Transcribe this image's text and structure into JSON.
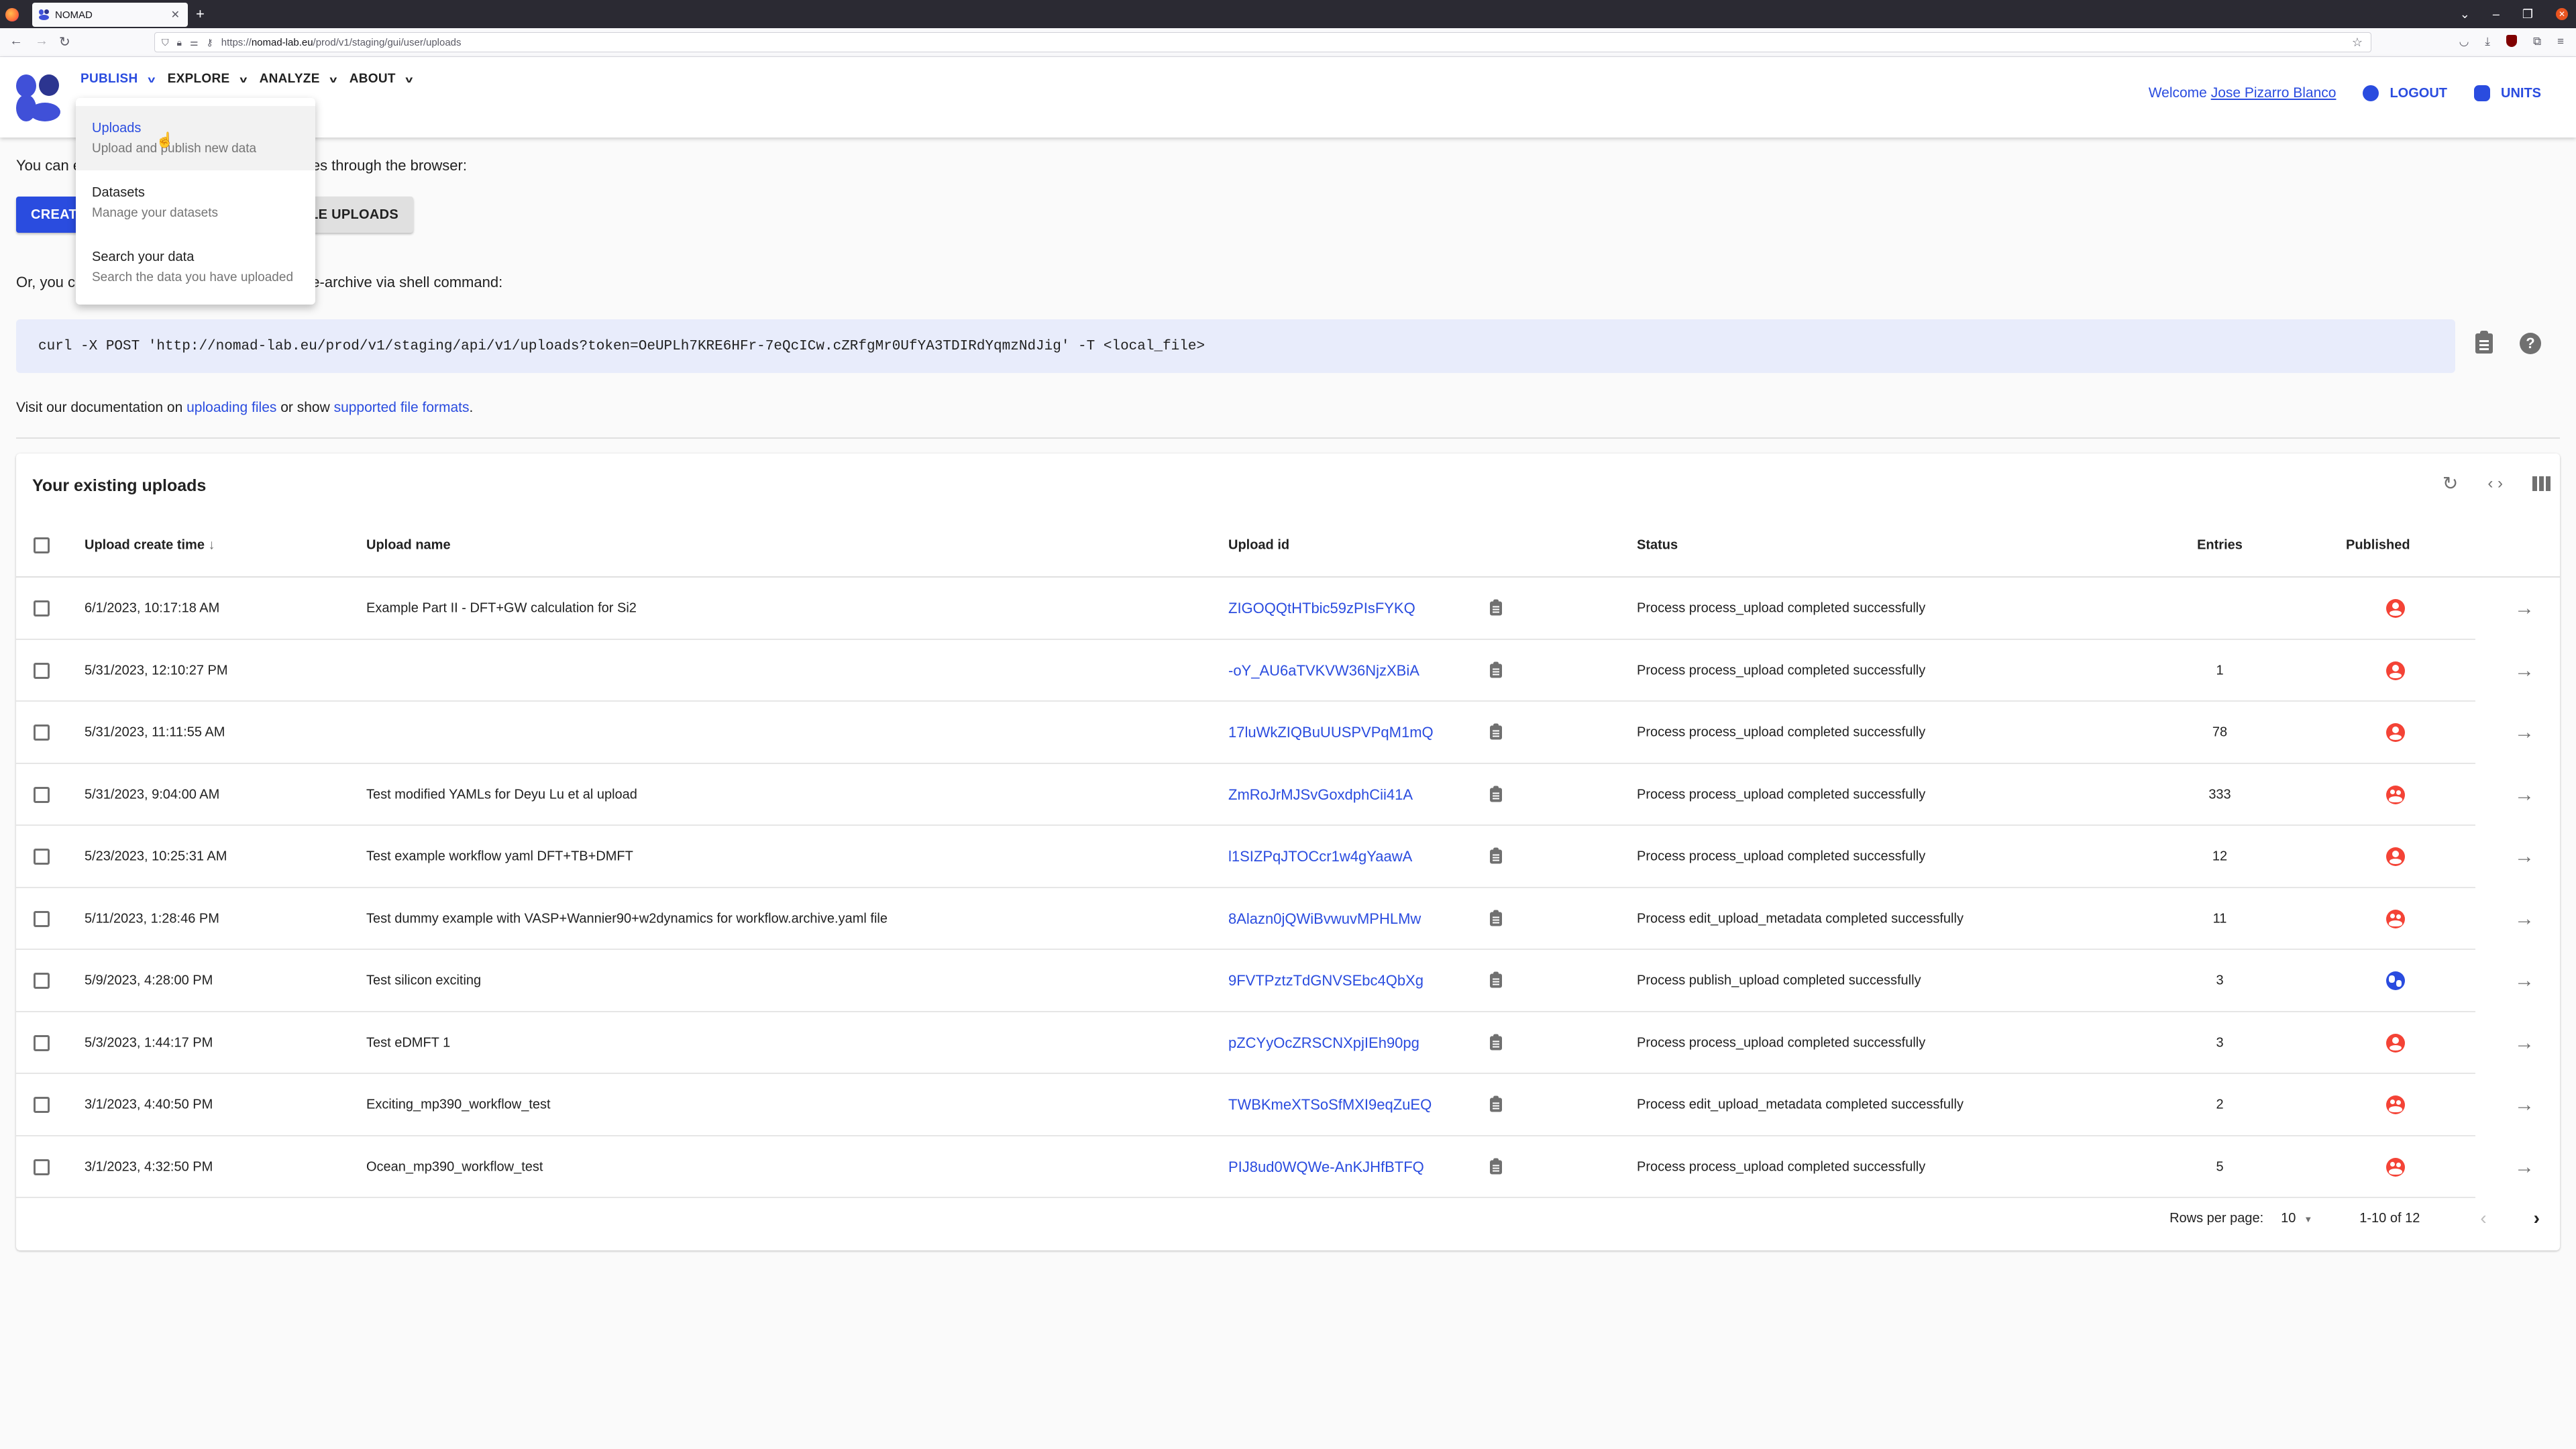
{
  "browser": {
    "tab_title": "NOMAD",
    "url_prefix": "https://",
    "url_host": "nomad-lab.eu",
    "url_path": "/prod/v1/staging/gui/user/uploads"
  },
  "header": {
    "nav": [
      {
        "label": "PUBLISH",
        "active": true
      },
      {
        "label": "EXPLORE",
        "active": false
      },
      {
        "label": "ANALYZE",
        "active": false
      },
      {
        "label": "ABOUT",
        "active": false
      }
    ],
    "welcome_prefix": "Welcome",
    "user_name": "Jose Pizarro Blanco",
    "logout_label": "LOGOUT",
    "units_label": "UNITS"
  },
  "publish_menu": [
    {
      "title": "Uploads",
      "subtitle": "Upload and publish new data"
    },
    {
      "title": "Datasets",
      "subtitle": "Manage your datasets"
    },
    {
      "title": "Search your data",
      "subtitle": "Search the data you have uploaded"
    }
  ],
  "intro": {
    "text_visible_left": "You can e",
    "text_visible_right": "iles through the browser:",
    "create_button": "CREATE",
    "example_button": "PLE UPLOADS",
    "shell_left": "Or, you ca",
    "shell_right": "e-archive via shell command:",
    "curl_command": "curl -X POST 'http://nomad-lab.eu/prod/v1/staging/api/v1/uploads?token=OeUPLh7KRE6HFr-7eQcICw.cZRfgMr0UfYA3TDIRdYqmzNdJig' -T <local_file>",
    "docs_prefix": "Visit our documentation on ",
    "docs_link1": "uploading files",
    "docs_middle": " or show ",
    "docs_link2": "supported file formats",
    "docs_suffix": "."
  },
  "uploads": {
    "title": "Your existing uploads",
    "columns": {
      "create_time": "Upload create time",
      "name": "Upload name",
      "id": "Upload id",
      "status": "Status",
      "entries": "Entries",
      "published": "Published"
    },
    "sort_icon": "arrow-down-icon",
    "rows": [
      {
        "time": "6/1/2023, 10:17:18 AM",
        "name": "Example Part II - DFT+GW calculation for Si2",
        "id": "ZIGOQQtHTbic59zPIsFYKQ",
        "status": "Process process_upload completed successfully",
        "entries": "",
        "published": "user"
      },
      {
        "time": "5/31/2023, 12:10:27 PM",
        "name": "",
        "id": "-oY_AU6aTVKVW36NjzXBiA",
        "status": "Process process_upload completed successfully",
        "entries": "1",
        "published": "user"
      },
      {
        "time": "5/31/2023, 11:11:55 AM",
        "name": "",
        "id": "17luWkZIQBuUUSPVPqM1mQ",
        "status": "Process process_upload completed successfully",
        "entries": "78",
        "published": "user"
      },
      {
        "time": "5/31/2023, 9:04:00 AM",
        "name": "Test modified YAMLs for Deyu Lu et al upload",
        "id": "ZmRoJrMJSvGoxdphCii41A",
        "status": "Process process_upload completed successfully",
        "entries": "333",
        "published": "group"
      },
      {
        "time": "5/23/2023, 10:25:31 AM",
        "name": "Test example workflow yaml DFT+TB+DMFT",
        "id": "l1SIZPqJTOCcr1w4gYaawA",
        "status": "Process process_upload completed successfully",
        "entries": "12",
        "published": "user"
      },
      {
        "time": "5/11/2023, 1:28:46 PM",
        "name": "Test dummy example with VASP+Wannier90+w2dynamics for workflow.archive.yaml file",
        "id": "8Alazn0jQWiBvwuvMPHLMw",
        "status": "Process edit_upload_metadata completed successfully",
        "entries": "11",
        "published": "group"
      },
      {
        "time": "5/9/2023, 4:28:00 PM",
        "name": "Test silicon exciting",
        "id": "9FVTPztzTdGNVSEbc4QbXg",
        "status": "Process publish_upload completed successfully",
        "entries": "3",
        "published": "world"
      },
      {
        "time": "5/3/2023, 1:44:17 PM",
        "name": "Test eDMFT 1",
        "id": "pZCYyOcZRSCNXpjIEh90pg",
        "status": "Process process_upload completed successfully",
        "entries": "3",
        "published": "user"
      },
      {
        "time": "3/1/2023, 4:40:50 PM",
        "name": "Exciting_mp390_workflow_test",
        "id": "TWBKmeXTSoSfMXI9eqZuEQ",
        "status": "Process edit_upload_metadata completed successfully",
        "entries": "2",
        "published": "group"
      },
      {
        "time": "3/1/2023, 4:32:50 PM",
        "name": "Ocean_mp390_workflow_test",
        "id": "PIJ8ud0WQWe-AnKJHfBTFQ",
        "status": "Process process_upload completed successfully",
        "entries": "5",
        "published": "group"
      }
    ],
    "pagination": {
      "rows_per_page_label": "Rows per page:",
      "rows_per_page": "10",
      "range": "1-10 of 12"
    }
  },
  "colors": {
    "primary": "#2a4cdf",
    "private_red": "#f44336",
    "code_bg": "#e8ecfb"
  }
}
